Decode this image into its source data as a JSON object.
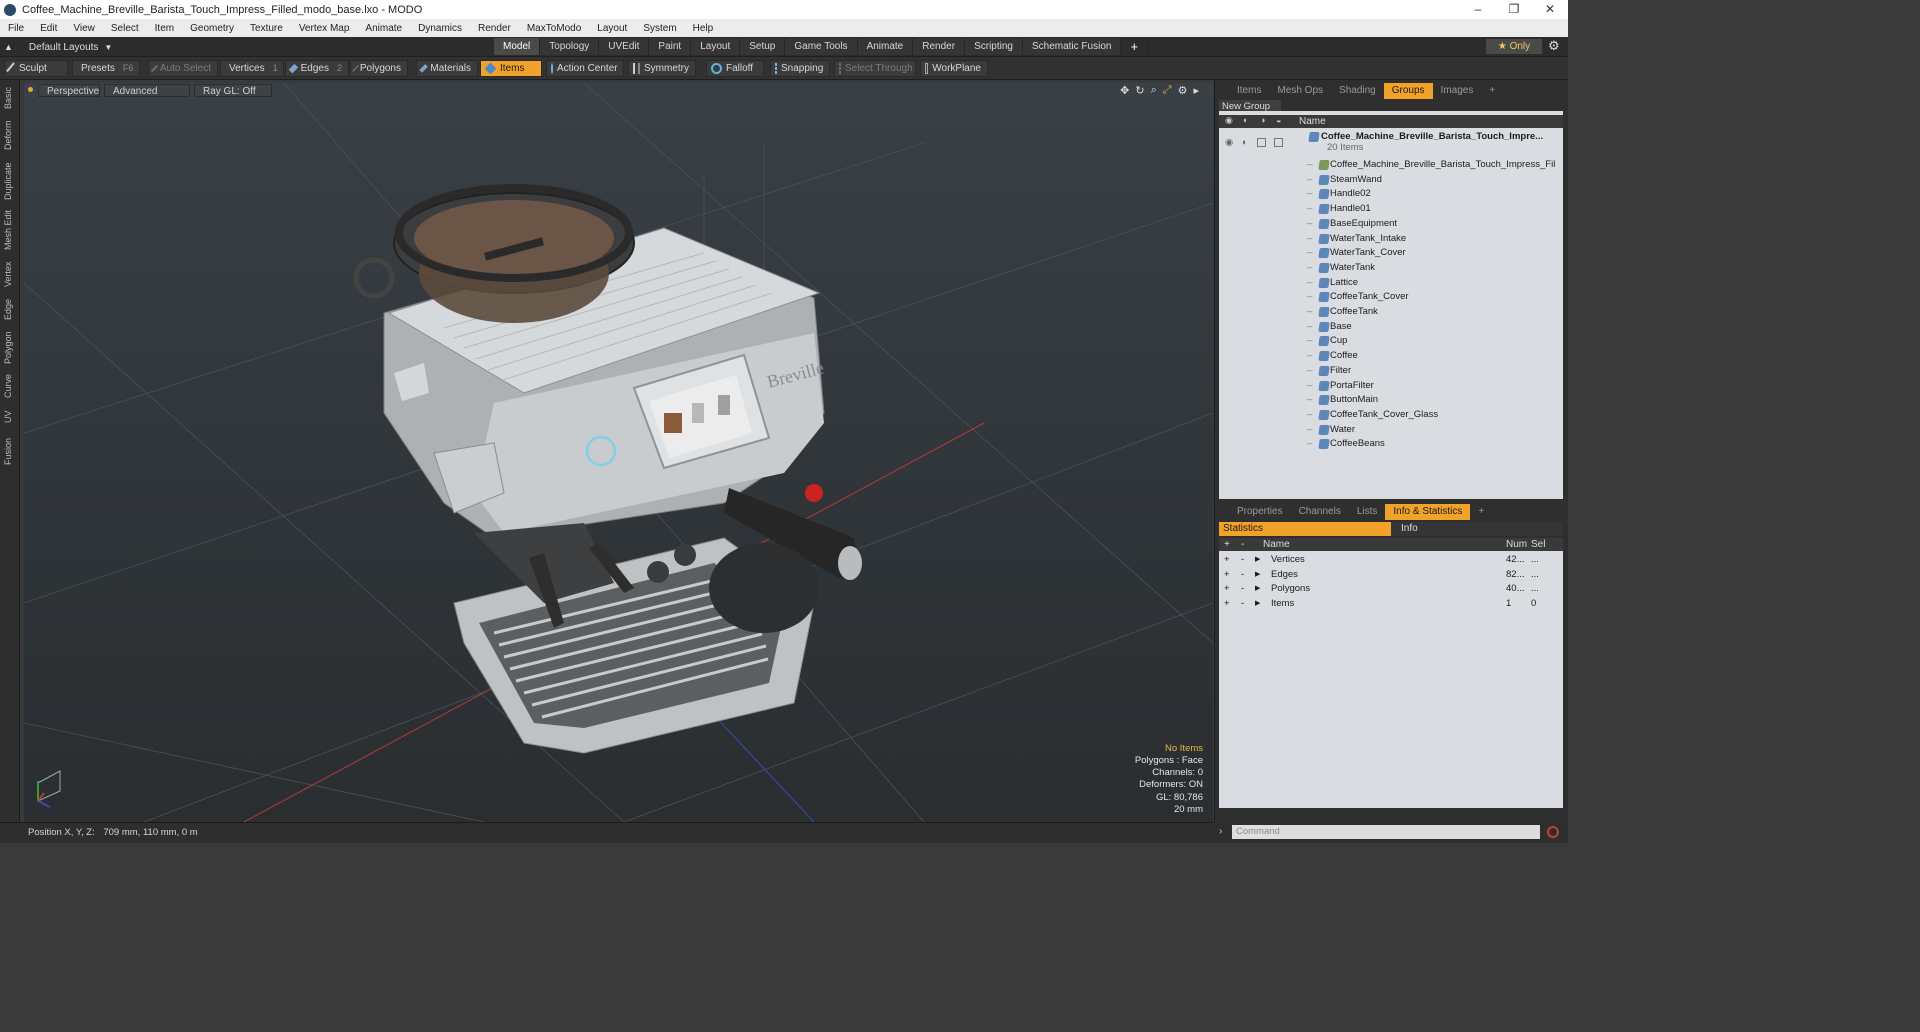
{
  "window": {
    "title": "Coffee_Machine_Breville_Barista_Touch_Impress_Filled_modo_base.lxo - MODO",
    "controls": [
      "–",
      "❐",
      "✕"
    ]
  },
  "menu": [
    "File",
    "Edit",
    "View",
    "Select",
    "Item",
    "Geometry",
    "Texture",
    "Vertex Map",
    "Animate",
    "Dynamics",
    "Render",
    "MaxToModo",
    "Layout",
    "System",
    "Help"
  ],
  "layout_bar": {
    "layout_name": "Default Layouts",
    "tabs": [
      "Model",
      "Topology",
      "UVEdit",
      "Paint",
      "Layout",
      "Setup",
      "Game Tools",
      "Animate",
      "Render",
      "Scripting",
      "Schematic Fusion"
    ],
    "active_tab": "Model",
    "add_tab": "+",
    "only_label": "★  Only"
  },
  "toolbar": {
    "sculpt": "Sculpt",
    "presets": "Presets",
    "presets_key": "F6",
    "auto_select": "Auto Select",
    "vertices": "Vertices",
    "vertices_key": "1",
    "edges": "Edges",
    "edges_key": "2",
    "polygons": "Polygons",
    "materials": "Materials",
    "items": "Items",
    "action_center": "Action Center",
    "symmetry": "Symmetry",
    "falloff": "Falloff",
    "snapping": "Snapping",
    "select_through": "Select Through",
    "workplane": "WorkPlane"
  },
  "left_tools": [
    "Basic",
    "Deform",
    "Duplicate",
    "Mesh Edit",
    "Vertex",
    "Edge",
    "Polygon",
    "Curve",
    "UV",
    "Fusion"
  ],
  "viewport": {
    "view": "Perspective",
    "shading": "Advanced",
    "raygl": "Ray GL: Off",
    "stats": {
      "no_items": "No Items",
      "polygons": "Polygons : Face",
      "channels": "Channels: 0",
      "deformers": "Deformers: ON",
      "gl": "GL: 80,786",
      "scale": "20 mm"
    },
    "model_brand": "Breville"
  },
  "status": {
    "position_label": "Position X, Y, Z:",
    "position_value": "709 mm, 110 mm, 0 m"
  },
  "groups_panel": {
    "tabs": [
      "Items",
      "Mesh Ops",
      "Shading",
      "Groups",
      "Images"
    ],
    "active_tab": "Groups",
    "new_group": "New Group",
    "column_name": "Name",
    "root": "Coffee_Machine_Breville_Barista_Touch_Impre...",
    "root_count": "20 Items",
    "items": [
      "Coffee_Machine_Breville_Barista_Touch_Impress_Filled",
      "SteamWand",
      "Handle02",
      "Handle01",
      "BaseEquipment",
      "WaterTank_Intake",
      "WaterTank_Cover",
      "WaterTank",
      "Lattice",
      "CoffeeTank_Cover",
      "CoffeeTank",
      "Base",
      "Cup",
      "Coffee",
      "Filter",
      "PortaFilter",
      "ButtonMain",
      "CoffeeTank_Cover_Glass",
      "Water",
      "CoffeeBeans"
    ]
  },
  "stats_panel": {
    "tabs": [
      "Properties",
      "Channels",
      "Lists",
      "Info & Statistics"
    ],
    "active_tab": "Info & Statistics",
    "subtabs": [
      "Statistics",
      "Info"
    ],
    "columns": [
      "Name",
      "Num",
      "Sel"
    ],
    "rows": [
      {
        "name": "Vertices",
        "num": "42...",
        "sel": "..."
      },
      {
        "name": "Edges",
        "num": "82...",
        "sel": "..."
      },
      {
        "name": "Polygons",
        "num": "40...",
        "sel": "..."
      },
      {
        "name": "Items",
        "num": "1",
        "sel": "0"
      }
    ]
  },
  "command": {
    "placeholder": "Command"
  },
  "colors": {
    "accent": "#f0a22a",
    "panel_bg": "#d9dde2",
    "viewport_bg": "#353b40"
  }
}
